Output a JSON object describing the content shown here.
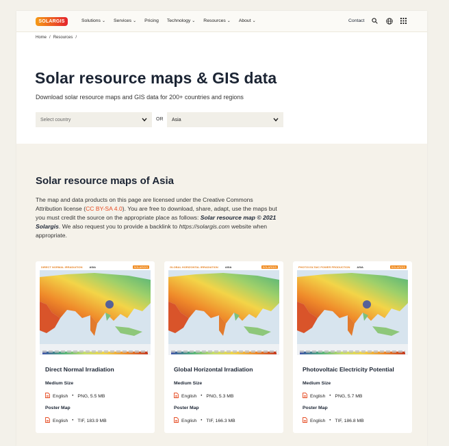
{
  "colors": {
    "accent": "#e64b22",
    "brand_from": "#f59b16",
    "brand_to": "#e4232d",
    "heading": "#1b2433",
    "hero_bg": "#ffffff",
    "section_bg": "#f5f2ea"
  },
  "header": {
    "logo": "SOLARGIS",
    "nav": [
      "Solutions",
      "Services",
      "Pricing",
      "Technology",
      "Resources",
      "About"
    ],
    "contact": "Contact"
  },
  "breadcrumb": [
    "Home",
    "/",
    "Resources",
    "/"
  ],
  "hero": {
    "title": "Solar resource maps & GIS data",
    "subtitle": "Download solar resource maps and GIS data for 200+ countries and regions",
    "country_select": "Select country",
    "or": "OR",
    "region_select": "Asia"
  },
  "section": {
    "title": "Solar resource maps of Asia",
    "p1": "The map and data products on this page are licensed under the Creative Commons Attribution license (",
    "license_link": "CC BY-SA 4.0",
    "p2": "). You are free to download, share, adapt, use the maps but you must credit the source on the appropriate place as follows: ",
    "credit": "Solar resource map © 2021 Solargis",
    "p3": ". We also request you to provide a backlink to ",
    "site": "https://solargis.com",
    "p4": " website when appropriate."
  },
  "cards": [
    {
      "map_title": "DIRECT NORMAL IRRADIATION",
      "map_region": "ASIA",
      "map_badge": "SOLARGIS",
      "title": "Direct Normal Irradiation",
      "medium_label": "Medium Size",
      "medium_lang": "English",
      "medium_file": "PNG, 5.5 MB",
      "poster_label": "Poster Map",
      "poster_lang": "English",
      "poster_file": "TIF, 183.9 MB"
    },
    {
      "map_title": "GLOBAL HORIZONTAL IRRADIATION",
      "map_region": "ASIA",
      "map_badge": "SOLARGIS",
      "title": "Global Horizontal Irradiation",
      "medium_label": "Medium Size",
      "medium_lang": "English",
      "medium_file": "PNG, 5.3 MB",
      "poster_label": "Poster Map",
      "poster_lang": "English",
      "poster_file": "TIF, 166.3 MB"
    },
    {
      "map_title": "PHOTOVOLTAIC POWER PRODUCTION",
      "map_region": "ASIA",
      "map_badge": "SOLARGIS",
      "title": "Photovoltaic Electricity Potential",
      "medium_label": "Medium Size",
      "medium_lang": "English",
      "medium_file": "PNG, 5.7 MB",
      "poster_label": "Poster Map",
      "poster_lang": "English",
      "poster_file": "TIF, 186.8 MB"
    }
  ]
}
